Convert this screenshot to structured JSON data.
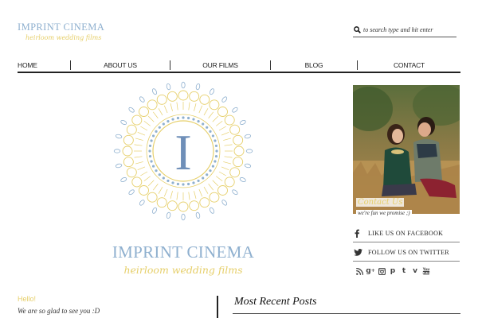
{
  "header": {
    "logo_title": "IMPRINT CINEMA",
    "logo_subtitle": "heirloom wedding films",
    "search_placeholder": "to search type and hit enter"
  },
  "nav": {
    "items": [
      {
        "label": "HOME"
      },
      {
        "label": "ABOUT US"
      },
      {
        "label": "OUR FILMS"
      },
      {
        "label": "BLOG"
      },
      {
        "label": "CONTACT"
      }
    ]
  },
  "emblem": {
    "letter": "I",
    "title": "IMPRINT CINEMA",
    "subtitle": "heirloom wedding films"
  },
  "greeting": {
    "title": "Hello!",
    "text": "We are so glad to see you :D"
  },
  "recent": {
    "title": "Most Recent Posts"
  },
  "sidebar": {
    "contact_label": "Contact Us",
    "contact_note": "we're fun we promise ;)",
    "facebook_label": "LIKE US ON FACEBOOK",
    "twitter_label": "FOLLOW US ON TWITTER",
    "social_icons": [
      "rss-icon",
      "google-plus-icon",
      "instagram-icon",
      "pinterest-icon",
      "tumblr-icon",
      "vimeo-icon",
      "youtube-icon"
    ]
  },
  "colors": {
    "accent_blue": "#8fb0cf",
    "accent_yellow": "#e6cf6a",
    "text_dark": "#222222"
  }
}
